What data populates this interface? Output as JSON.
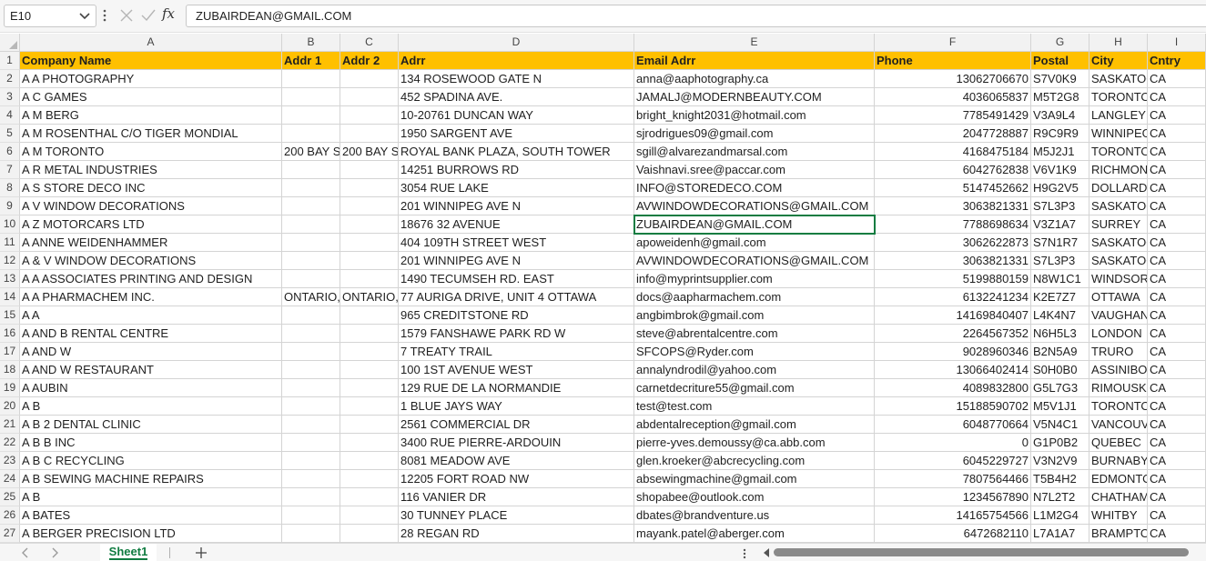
{
  "formula_bar": {
    "name_box": "E10",
    "fx_label": "fx",
    "formula_value": "ZUBAIRDEAN@GMAIL.COM"
  },
  "columns": [
    "A",
    "B",
    "C",
    "D",
    "E",
    "F",
    "G",
    "H",
    "I"
  ],
  "header_row": [
    "Company Name",
    "Addr 1",
    "Addr 2",
    "Adrr",
    "Email Adrr",
    "Phone",
    "Postal",
    "City",
    "Cntry"
  ],
  "rows": [
    [
      "A  A PHOTOGRAPHY",
      "",
      "",
      "134 ROSEWOOD GATE N",
      "anna@aaphotography.ca",
      "13062706670",
      "S7V0K9",
      "SASKATOON",
      "CA"
    ],
    [
      "A  C GAMES",
      "",
      "",
      "452 SPADINA AVE.",
      "JAMALJ@MODERNBEAUTY.COM",
      "4036065837",
      "M5T2G8",
      "TORONTO",
      "CA"
    ],
    [
      "A  M BERG",
      "",
      "",
      "10-20761 DUNCAN WAY",
      "bright_knight2031@hotmail.com",
      "7785491429",
      "V3A9L4",
      "LANGLEY",
      "CA"
    ],
    [
      "A  M ROSENTHAL C/O TIGER MONDIAL",
      "",
      "",
      "1950 SARGENT AVE",
      "sjrodrigues09@gmail.com",
      "2047728887",
      "R9C9R9",
      "WINNIPEG",
      "CA"
    ],
    [
      "A  M TORONTO",
      "200 BAY ST",
      "200 BAY ST",
      "ROYAL BANK PLAZA, SOUTH TOWER",
      "sgill@alvarezandmarsal.com",
      "4168475184",
      "M5J2J1",
      "TORONTO",
      "CA"
    ],
    [
      "A  R METAL INDUSTRIES",
      "",
      "",
      "14251 BURROWS RD",
      "Vaishnavi.sree@paccar.com",
      "6042762838",
      "V6V1K9",
      "RICHMOND",
      "CA"
    ],
    [
      "A  S STORE DECO INC",
      "",
      "",
      "3054 RUE LAKE",
      "INFO@STOREDECO.COM",
      "5147452662",
      "H9G2V5",
      "DOLLARD-DES-ORMEAUX",
      "CA"
    ],
    [
      "A  V WINDOW DECORATIONS",
      "",
      "",
      "201 WINNIPEG AVE N",
      "AVWINDOWDECORATIONS@GMAIL.COM",
      "3063821331",
      "S7L3P3",
      "SASKATOON",
      "CA"
    ],
    [
      "A  Z MOTORCARS LTD",
      "",
      "",
      "18676 32 AVENUE",
      "ZUBAIRDEAN@GMAIL.COM",
      "7788698634",
      "V3Z1A7",
      "SURREY",
      "CA"
    ],
    [
      "A  ANNE   WEIDENHAMMER",
      "",
      "",
      "404 109TH STREET WEST",
      "apoweidenh@gmail.com",
      "3062622873",
      "S7N1R7",
      "SASKATOON",
      "CA"
    ],
    [
      "A & V WINDOW DECORATIONS",
      "",
      "",
      "201 WINNIPEG AVE N",
      "AVWINDOWDECORATIONS@GMAIL.COM",
      "3063821331",
      "S7L3P3",
      "SASKATOON",
      "CA"
    ],
    [
      "A A ASSOCIATES PRINTING AND DESIGN",
      "",
      "",
      "1490 TECUMSEH RD. EAST",
      "info@myprintsupplier.com",
      "5199880159",
      "N8W1C1",
      "WINDSOR",
      "CA"
    ],
    [
      "A A PHARMACHEM INC.",
      "ONTARIO,",
      "ONTARIO,",
      "77 AURIGA DRIVE, UNIT 4 OTTAWA",
      "docs@aapharmachem.com",
      "6132241234",
      "K2E7Z7",
      "OTTAWA",
      "CA"
    ],
    [
      "A A",
      "",
      "",
      "965 CREDITSTONE RD",
      "angbimbrok@gmail.com",
      "14169840407",
      "L4K4N7",
      "VAUGHAN",
      "CA"
    ],
    [
      "A AND B RENTAL CENTRE",
      "",
      "",
      "1579 FANSHAWE PARK RD W",
      "steve@abrentalcentre.com",
      "2264567352",
      "N6H5L3",
      "LONDON",
      "CA"
    ],
    [
      "A AND W",
      "",
      "",
      "7 TREATY TRAIL",
      "SFCOPS@Ryder.com",
      "9028960346",
      "B2N5A9",
      "TRURO",
      "CA"
    ],
    [
      "A AND W RESTAURANT",
      "",
      "",
      "100 1ST AVENUE WEST",
      "annalyndrodil@yahoo.com",
      "13066402414",
      "S0H0B0",
      "ASSINIBOIA",
      "CA"
    ],
    [
      "A AUBIN",
      "",
      "",
      "129 RUE DE LA NORMANDIE",
      "carnetdecriture55@gmail.com",
      "4089832800",
      "G5L7G3",
      "RIMOUSKI",
      "CA"
    ],
    [
      "A B",
      "",
      "",
      "1 BLUE JAYS WAY",
      "test@test.com",
      "15188590702",
      "M5V1J1",
      "TORONTO",
      "CA"
    ],
    [
      "A B 2 DENTAL CLINIC",
      "",
      "",
      "2561 COMMERCIAL DR",
      "abdentalreception@gmail.com",
      "6048770664",
      "V5N4C1",
      "VANCOUVER",
      "CA"
    ],
    [
      "A B B INC",
      "",
      "",
      "3400 RUE PIERRE-ARDOUIN",
      "pierre-yves.demoussy@ca.abb.com",
      "0",
      "G1P0B2",
      "QUEBEC",
      "CA"
    ],
    [
      "A B C RECYCLING",
      "",
      "",
      "8081 MEADOW AVE",
      "glen.kroeker@abcrecycling.com",
      "6045229727",
      "V3N2V9",
      "BURNABY",
      "CA"
    ],
    [
      "A B SEWING MACHINE REPAIRS",
      "",
      "",
      "12205 FORT ROAD NW",
      "absewingmachine@gmail.com",
      "7807564466",
      "T5B4H2",
      "EDMONTON",
      "CA"
    ],
    [
      "A B",
      "",
      "",
      "116 VANIER DR",
      "shopabee@outlook.com",
      "1234567890",
      "N7L2T2",
      "CHATHAM",
      "CA"
    ],
    [
      "A BATES",
      "",
      "",
      "30 TUNNEY PLACE",
      "dbates@brandventure.us",
      "14165754566",
      "L1M2G4",
      "WHITBY",
      "CA"
    ],
    [
      "A BERGER PRECISION LTD",
      "",
      "",
      "28 REGAN RD",
      "mayank.patel@aberger.com",
      "6472682110",
      "L7A1A7",
      "BRAMPTON",
      "CA"
    ]
  ],
  "sheet_tab": "Sheet1",
  "icons": {
    "name_box_dropdown": "chevron-down-icon",
    "cancel": "x-icon",
    "enter": "check-icon",
    "add_sheet": "plus-icon"
  },
  "colors": {
    "header_fill": "#ffc000",
    "accent": "#107c41"
  }
}
